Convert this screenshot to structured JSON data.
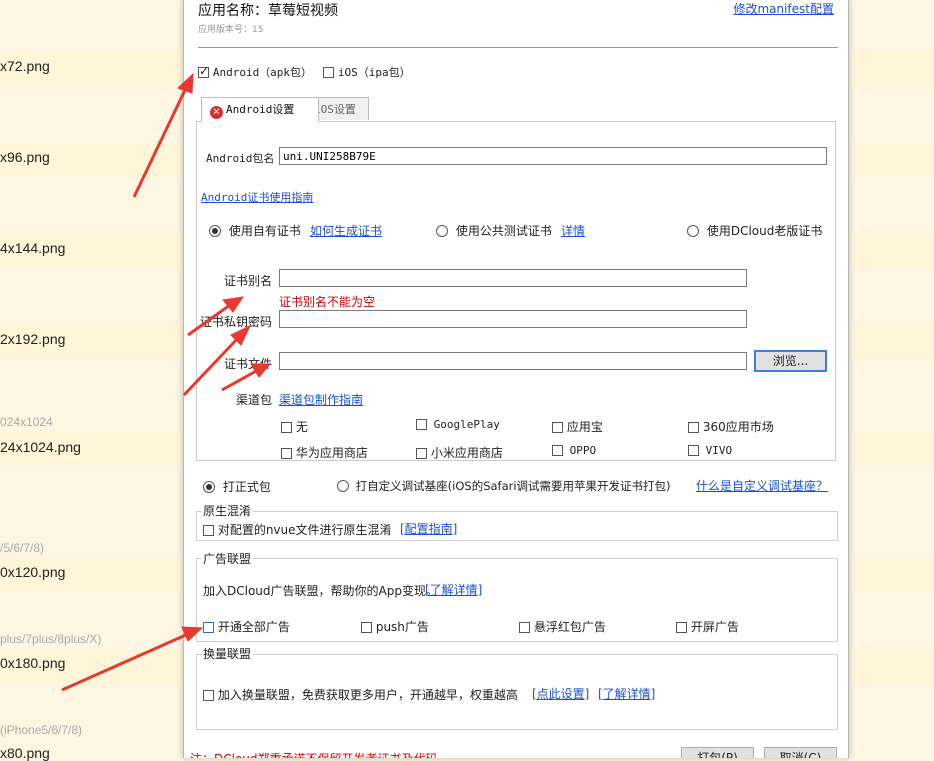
{
  "background": {
    "files": [
      "x72.png",
      "x96.png",
      "4x144.png",
      "2x192.png",
      "24x1024.png",
      "0x120.png",
      "0x180.png",
      "x80.png"
    ],
    "captions": [
      "024x1024",
      "/5/6/7/8)",
      "plus/7plus/8plus/X)",
      "(iPhone5/6/7/8)"
    ]
  },
  "dialog": {
    "title": "应用名称：草莓短视频",
    "version": "应用版本号：15",
    "manifest_link": "修改manifest配置",
    "platforms": {
      "android": "Android（apk包）",
      "ios": "iOS（ipa包）"
    },
    "tabs": {
      "android": "Android设置",
      "ios": "iOS设置"
    },
    "android": {
      "package_label": "Android包名",
      "package_value": "uni.UNI258B79E",
      "cert_guide_link": "Android证书使用指南",
      "cert_options": {
        "own": "使用自有证书",
        "how_link": "如何生成证书",
        "public": "使用公共测试证书",
        "detail_link": "详情",
        "dcloud": "使用DCloud老版证书"
      },
      "alias_label": "证书别名",
      "alias_error": "证书别名不能为空",
      "password_label": "证书私钥密码",
      "file_label": "证书文件",
      "browse_button": "浏览...",
      "channel_label": "渠道包",
      "channel_guide_link": "渠道包制作指南",
      "channels": [
        "无",
        "GooglePlay",
        "应用宝",
        "360应用市场",
        "华为应用商店",
        "小米应用商店",
        "OPPO",
        "VIVO"
      ]
    },
    "build": {
      "release": "打正式包",
      "custom": "打自定义调试基座(iOS的Safari调试需要用苹果开发证书打包)",
      "custom_link": "什么是自定义调试基座？"
    },
    "obfuscation": {
      "title": "原生混淆",
      "option": "对配置的nvue文件进行原生混淆",
      "guide_link": "[配置指南]"
    },
    "ads": {
      "title": "广告联盟",
      "desc": "加入DCloud广告联盟，帮助你的App变现。",
      "detail_link": "[了解详情]",
      "options": [
        "开通全部广告",
        "push广告",
        "悬浮红包广告",
        "开屏广告"
      ]
    },
    "exchange": {
      "title": "换量联盟",
      "option": "加入换量联盟，免费获取更多用户，开通越早，权重越高",
      "settings_link": "[点此设置]",
      "detail_link": "[了解详情]"
    },
    "footer": {
      "note": "注：DCloud郑重承诺不保留开发者证书及代码",
      "pack_button": "打包(P)",
      "cancel_button": "取消(C)"
    }
  },
  "colors": {
    "link": "#1a4fd6",
    "error": "#d40000",
    "arrow": "#e8392f",
    "focus": "#3c7fd9"
  }
}
